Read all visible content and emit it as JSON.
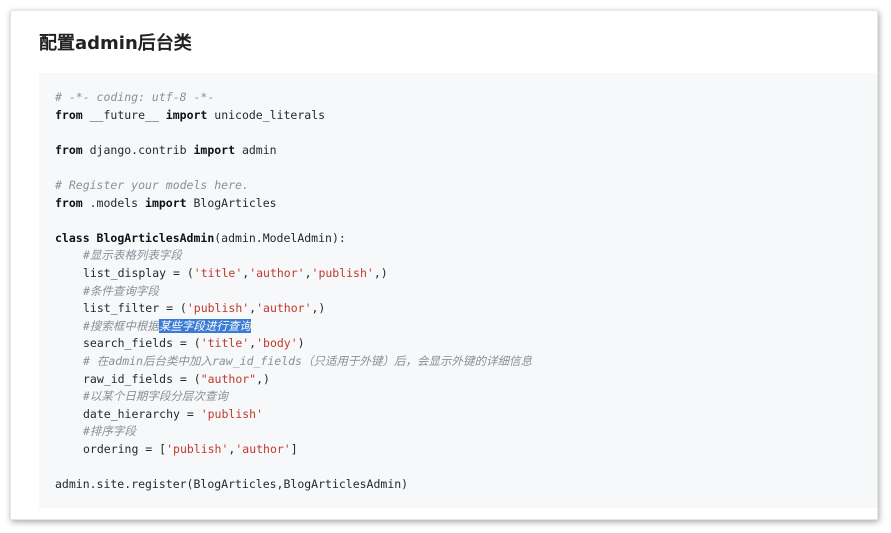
{
  "title": "配置admin后台类",
  "code": {
    "l1": "# -*- coding: utf-8 -*-",
    "l2": {
      "kw1": "from",
      "mod": " __future__ ",
      "kw2": "import",
      "name": " unicode_literals"
    },
    "l4": {
      "kw1": "from",
      "mod": " django.contrib ",
      "kw2": "import",
      "name": " admin"
    },
    "l6": "# Register your models here.",
    "l7": {
      "kw1": "from",
      "mod": " .models ",
      "kw2": "import",
      "name": " BlogArticles"
    },
    "l9": {
      "kw": "class",
      "name": " BlogArticlesAdmin",
      "rest": "(admin.ModelAdmin):"
    },
    "c1": "#显示表格列表字段",
    "s1": {
      "pre": "list_display = (",
      "a": "'title'",
      "b": "'author'",
      "c": "'publish'",
      "post": ",)"
    },
    "c2": "#条件查询字段",
    "s2": {
      "pre": "list_filter = (",
      "a": "'publish'",
      "b": "'author'",
      "post": ",)"
    },
    "c3a": "#搜索框中根据",
    "c3b": "某些字段进行查询",
    "s3": {
      "pre": "search_fields = (",
      "a": "'title'",
      "b": "'body'",
      "post": ")"
    },
    "c4": "# 在admin后台类中加入raw_id_fields（只适用于外键）后，会显示外键的详细信息",
    "s4": {
      "pre": "raw_id_fields = (",
      "a": "\"author\"",
      "post": ",)"
    },
    "c5": "#以某个日期字段分层次查询",
    "s5": {
      "pre": "date_hierarchy = ",
      "a": "'publish'"
    },
    "c6": "#排序字段",
    "s6": {
      "pre": "ordering = [",
      "a": "'publish'",
      "b": "'author'",
      "post": "]"
    },
    "last": "admin.site.register(BlogArticles,BlogArticlesAdmin)"
  }
}
